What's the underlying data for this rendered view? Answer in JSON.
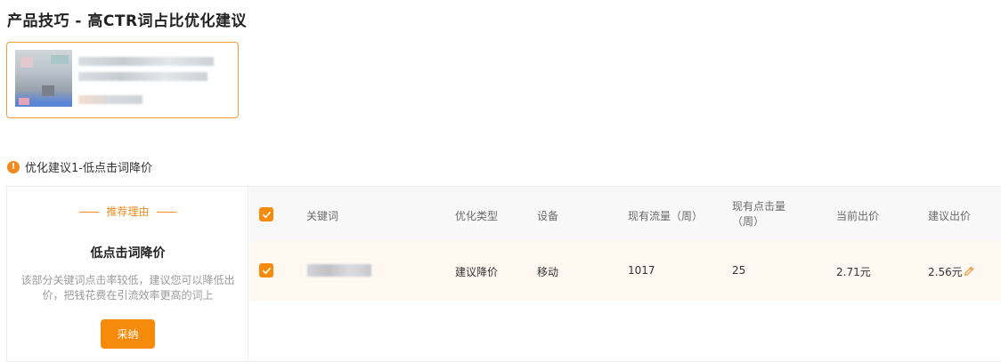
{
  "page": {
    "title": "产品技巧 - 高CTR词占比优化建议"
  },
  "section": {
    "icon": "info-icon",
    "title": "优化建议1-低点击词降价"
  },
  "reason": {
    "tag": "推荐理由",
    "title": "低点击词降价",
    "description": "该部分关键词点击率较低，建议您可以降低出价，把钱花费在引流效率更高的词上",
    "adopt_label": "采纳"
  },
  "table": {
    "headers": {
      "keyword": "关键词",
      "opt_type": "优化类型",
      "device": "设备",
      "traffic": "现有流量（周）",
      "clicks": "现有点击量（周）",
      "current_bid": "当前出价",
      "suggested_bid": "建议出价"
    },
    "rows": [
      {
        "checked": true,
        "opt_type": "建议降价",
        "device": "移动",
        "traffic": "1017",
        "clicks": "25",
        "current_bid": "2.71元",
        "suggested_bid": "2.56元"
      }
    ]
  },
  "colors": {
    "accent": "#f58a0b",
    "card_border": "#f0a030",
    "row_highlight": "#fff8f1"
  }
}
